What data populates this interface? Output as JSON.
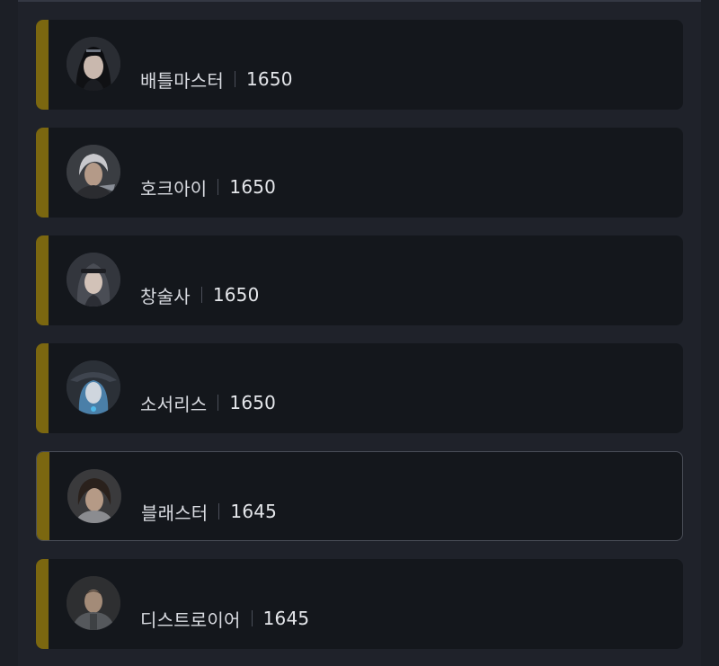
{
  "characters": [
    {
      "class_name": "배틀마스터",
      "item_level": "1650",
      "avatar_icon": "battlemaster-portrait-icon",
      "selected": false
    },
    {
      "class_name": "호크아이",
      "item_level": "1650",
      "avatar_icon": "hawkeye-portrait-icon",
      "selected": false
    },
    {
      "class_name": "창술사",
      "item_level": "1650",
      "avatar_icon": "lancemaster-portrait-icon",
      "selected": false
    },
    {
      "class_name": "소서리스",
      "item_level": "1650",
      "avatar_icon": "sorceress-portrait-icon",
      "selected": false
    },
    {
      "class_name": "블래스터",
      "item_level": "1645",
      "avatar_icon": "blaster-portrait-icon",
      "selected": true
    },
    {
      "class_name": "디스트로이어",
      "item_level": "1645",
      "avatar_icon": "destroyer-portrait-icon",
      "selected": false
    }
  ],
  "colors": {
    "accent": "#7b6710",
    "card_bg": "#14171c",
    "panel_bg": "#1f222a",
    "text": "#d9dbe1"
  }
}
